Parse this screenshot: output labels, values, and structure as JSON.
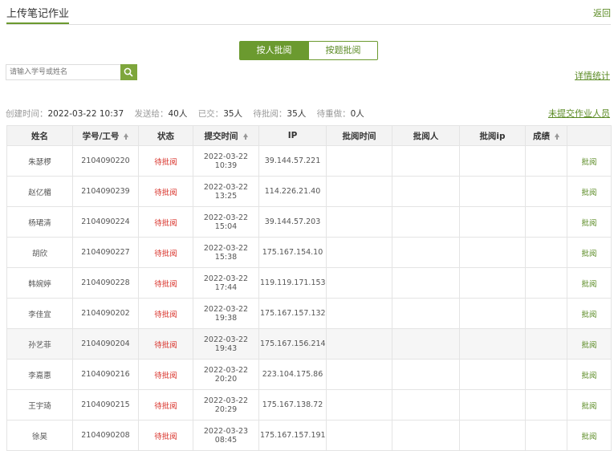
{
  "header": {
    "title": "上传笔记作业",
    "back_label": "返回"
  },
  "view_toggle": {
    "by_person": "按人批阅",
    "by_question": "按题批阅"
  },
  "search": {
    "placeholder": "请输入学号或姓名"
  },
  "detail_link": "详情统计",
  "stats": {
    "created_label": "创建时间：",
    "created_value": "2022-03-22 10:37",
    "sent_label": "发送给：",
    "sent_value": "40人",
    "submitted_label": "已交：",
    "submitted_value": "35人",
    "pending_label": "待批阅：",
    "pending_value": "35人",
    "redo_label": "待重做：",
    "redo_value": "0人"
  },
  "unsubmitted_link": "未提交作业人员",
  "table": {
    "headers": [
      "姓名",
      "学号/工号",
      "状态",
      "提交时间",
      "IP",
      "批阅时间",
      "批阅人",
      "批阅ip",
      "成绩",
      ""
    ],
    "rows": [
      {
        "name": "朱瑟椤",
        "id": "2104090220",
        "status": "待批阅",
        "date": "2022-03-22",
        "time": "10:39",
        "ip": "39.144.57.221",
        "action": "批阅"
      },
      {
        "name": "赵亿楣",
        "id": "2104090239",
        "status": "待批阅",
        "date": "2022-03-22",
        "time": "13:25",
        "ip": "114.226.21.40",
        "action": "批阅"
      },
      {
        "name": "杨珺清",
        "id": "2104090224",
        "status": "待批阅",
        "date": "2022-03-22",
        "time": "15:04",
        "ip": "39.144.57.203",
        "action": "批阅"
      },
      {
        "name": "胡欣",
        "id": "2104090227",
        "status": "待批阅",
        "date": "2022-03-22",
        "time": "15:38",
        "ip": "175.167.154.10",
        "action": "批阅"
      },
      {
        "name": "韩婉婷",
        "id": "2104090228",
        "status": "待批阅",
        "date": "2022-03-22",
        "time": "17:44",
        "ip": "119.119.171.153",
        "action": "批阅"
      },
      {
        "name": "李佳宜",
        "id": "2104090202",
        "status": "待批阅",
        "date": "2022-03-22",
        "time": "19:38",
        "ip": "175.167.157.132",
        "action": "批阅"
      },
      {
        "name": "孙艺菲",
        "id": "2104090204",
        "status": "待批阅",
        "date": "2022-03-22",
        "time": "19:43",
        "ip": "175.167.156.214",
        "action": "批阅"
      },
      {
        "name": "李嘉惠",
        "id": "2104090216",
        "status": "待批阅",
        "date": "2022-03-22",
        "time": "20:20",
        "ip": "223.104.175.86",
        "action": "批阅"
      },
      {
        "name": "王宇琦",
        "id": "2104090215",
        "status": "待批阅",
        "date": "2022-03-22",
        "time": "20:29",
        "ip": "175.167.138.72",
        "action": "批阅"
      },
      {
        "name": "徐昊",
        "id": "2104090208",
        "status": "待批阅",
        "date": "2022-03-23",
        "time": "08:45",
        "ip": "175.167.157.191",
        "action": "批阅"
      }
    ]
  },
  "colors": {
    "accent": "#6b9a2f",
    "link": "#5a8a23",
    "pending": "#d9332b"
  }
}
